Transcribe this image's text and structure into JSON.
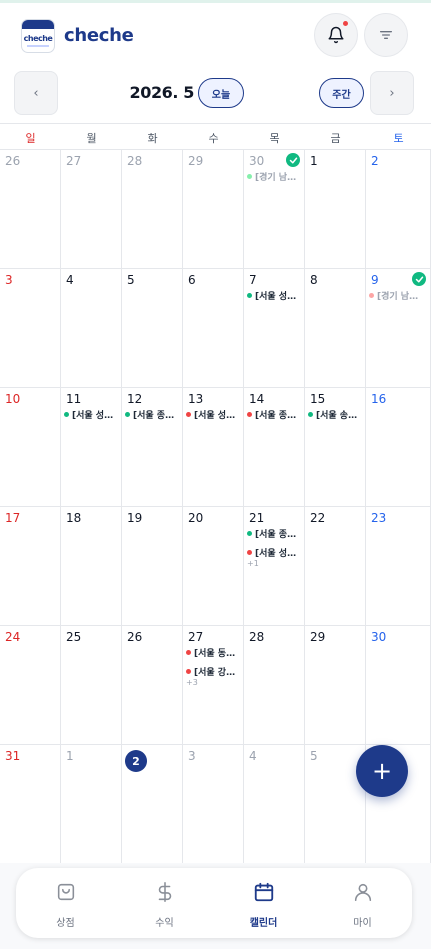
{
  "header": {
    "logo_text": "cheche",
    "app_name": "cheche"
  },
  "calendar_nav": {
    "prev_label": "‹",
    "next_label": "›",
    "month_label": "2026. 5",
    "today_label": "오늘",
    "week_label": "주간"
  },
  "weekdays": [
    "일",
    "월",
    "화",
    "수",
    "목",
    "금",
    "토"
  ],
  "weeks": [
    [
      {
        "day": "26",
        "out": true
      },
      {
        "day": "27",
        "out": true
      },
      {
        "day": "28",
        "out": true
      },
      {
        "day": "29",
        "out": true
      },
      {
        "day": "30",
        "out": true,
        "check": true,
        "events": [
          {
            "text": "[경기 남…",
            "color": "#86efac",
            "faded": true
          }
        ]
      },
      {
        "day": "1"
      },
      {
        "day": "2"
      }
    ],
    [
      {
        "day": "3"
      },
      {
        "day": "4"
      },
      {
        "day": "5"
      },
      {
        "day": "6"
      },
      {
        "day": "7",
        "events": [
          {
            "text": "[서울 성…",
            "color": "#10b981"
          }
        ]
      },
      {
        "day": "8"
      },
      {
        "day": "9",
        "check": true,
        "events": [
          {
            "text": "[경기 남…",
            "color": "#fca5a5",
            "faded": true
          }
        ]
      }
    ],
    [
      {
        "day": "10"
      },
      {
        "day": "11",
        "events": [
          {
            "text": "[서울 성…",
            "color": "#10b981"
          }
        ]
      },
      {
        "day": "12",
        "events": [
          {
            "text": "[서울 종…",
            "color": "#10b981"
          }
        ]
      },
      {
        "day": "13",
        "events": [
          {
            "text": "[서울 성…",
            "color": "#ef4444"
          }
        ]
      },
      {
        "day": "14",
        "events": [
          {
            "text": "[서울 종…",
            "color": "#ef4444"
          }
        ]
      },
      {
        "day": "15",
        "events": [
          {
            "text": "[서울 송…",
            "color": "#10b981"
          }
        ]
      },
      {
        "day": "16"
      }
    ],
    [
      {
        "day": "17"
      },
      {
        "day": "18"
      },
      {
        "day": "19"
      },
      {
        "day": "20"
      },
      {
        "day": "21",
        "events": [
          {
            "text": "[서울 종…",
            "color": "#10b981"
          },
          {
            "text": "[서울 성…",
            "color": "#ef4444"
          }
        ],
        "more": "+1"
      },
      {
        "day": "22"
      },
      {
        "day": "23"
      }
    ],
    [
      {
        "day": "24"
      },
      {
        "day": "25"
      },
      {
        "day": "26"
      },
      {
        "day": "27",
        "events": [
          {
            "text": "[서울 동…",
            "color": "#ef4444"
          },
          {
            "text": "[서울 강…",
            "color": "#ef4444"
          }
        ],
        "more": "+3"
      },
      {
        "day": "28"
      },
      {
        "day": "29"
      },
      {
        "day": "30"
      }
    ],
    [
      {
        "day": "31"
      },
      {
        "day": "1",
        "out": true
      },
      {
        "day": "2",
        "out": true,
        "today": true
      },
      {
        "day": "3",
        "out": true
      },
      {
        "day": "4",
        "out": true
      },
      {
        "day": "5",
        "out": true
      },
      {
        "day": ""
      }
    ]
  ],
  "fab_label": "+",
  "bottom_nav": [
    {
      "label": "상점",
      "icon": "bag-icon",
      "active": false
    },
    {
      "label": "수익",
      "icon": "dollar-icon",
      "active": false
    },
    {
      "label": "캘린더",
      "icon": "calendar-icon",
      "active": true
    },
    {
      "label": "마이",
      "icon": "person-icon",
      "active": false
    }
  ],
  "colors": {
    "brand": "#1e3a8a",
    "sunday": "#dc2626",
    "saturday": "#2563eb",
    "done": "#10b981",
    "alert": "#ef4444"
  }
}
